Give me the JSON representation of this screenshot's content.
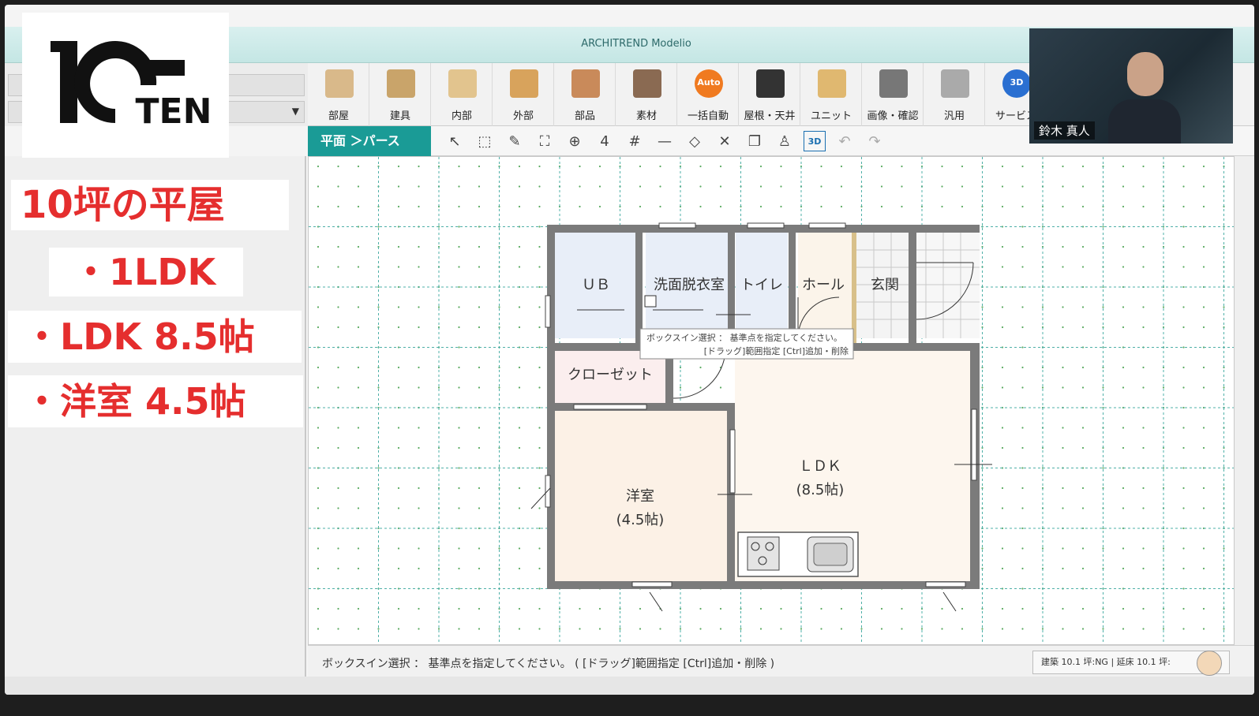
{
  "app": {
    "title": "ARCHITREND Modelio"
  },
  "logo": {
    "brand": "10TEN"
  },
  "overlay_labels": [
    "10坪の平屋",
    "・1LDK",
    "・LDK 8.5帖",
    "・洋室 4.5帖"
  ],
  "webcam": {
    "name": "鈴木 真人"
  },
  "toolbar": {
    "items": [
      {
        "label": "部屋",
        "icon": "room-icon",
        "color": "#d9b98a"
      },
      {
        "label": "建具",
        "icon": "door-window-icon",
        "color": "#c9a46a"
      },
      {
        "label": "内部",
        "icon": "interior-icon",
        "color": "#e2c48e"
      },
      {
        "label": "外部",
        "icon": "exterior-deck-icon",
        "color": "#d8a35c"
      },
      {
        "label": "部品",
        "icon": "parts-icon",
        "color": "#c98a5a"
      },
      {
        "label": "素材",
        "icon": "materials-icon",
        "color": "#8a6a52"
      },
      {
        "label": "一括自動",
        "icon": "auto-icon",
        "color": "#f07a20",
        "badge": "Auto"
      },
      {
        "label": "屋根・天井",
        "icon": "roof-icon",
        "color": "#333333"
      },
      {
        "label": "ユニット",
        "icon": "unit-icon",
        "color": "#e0b870"
      },
      {
        "label": "画像・確認",
        "icon": "image-check-icon",
        "color": "#777777"
      },
      {
        "label": "汎用",
        "icon": "general-icon",
        "color": "#aaaaaa"
      },
      {
        "label": "サービス",
        "icon": "service-3d-icon",
        "color": "#2a6fd1",
        "badge": "3D"
      }
    ]
  },
  "subtoolbar": {
    "view_tab": "平面 ＞パース",
    "tools": [
      {
        "icon": "select-arrow-icon",
        "glyph": "↖"
      },
      {
        "icon": "box-select-icon",
        "glyph": "⬚"
      },
      {
        "icon": "eyedropper-icon",
        "glyph": "✎"
      },
      {
        "icon": "fit-all-icon",
        "glyph": "⛶"
      },
      {
        "icon": "zoom-in-icon",
        "glyph": "⊕"
      },
      {
        "icon": "grid-step-icon",
        "glyph": "4"
      },
      {
        "icon": "grid-icon",
        "glyph": "#"
      },
      {
        "icon": "line-icon",
        "glyph": "—"
      },
      {
        "icon": "eraser-icon",
        "glyph": "◇"
      },
      {
        "icon": "tools-icon",
        "glyph": "✕"
      },
      {
        "icon": "copy-icon",
        "glyph": "❐"
      },
      {
        "icon": "figure-icon",
        "glyph": "♙"
      },
      {
        "icon": "view-3d-icon",
        "glyph": "3D"
      },
      {
        "icon": "undo-icon",
        "glyph": "↶"
      },
      {
        "icon": "redo-icon",
        "glyph": "↷"
      }
    ]
  },
  "floorplan": {
    "rooms": {
      "ub": "ＵＢ",
      "washroom": "洗面脱衣室",
      "toilet": "トイレ",
      "hall": "ホール",
      "entrance": "玄関",
      "closet": "クローゼット",
      "western": "洋室",
      "western_area": "(4.5帖)",
      "ldk": "ＬＤＫ",
      "ldk_area": "(8.5帖)"
    },
    "tooltip_line1": "ボックスイン選択 ： 基準点を指定してください。",
    "tooltip_line2": "[ドラッグ]範囲指定 [Ctrl]追加・削除"
  },
  "status": {
    "message": "ボックスイン選択 ： 基準点を指定してください。 ( [ドラッグ]範囲指定 [Ctrl]追加・削除 )",
    "area": "建築 10.1 坪:NG | 延床 10.1 坪:"
  }
}
